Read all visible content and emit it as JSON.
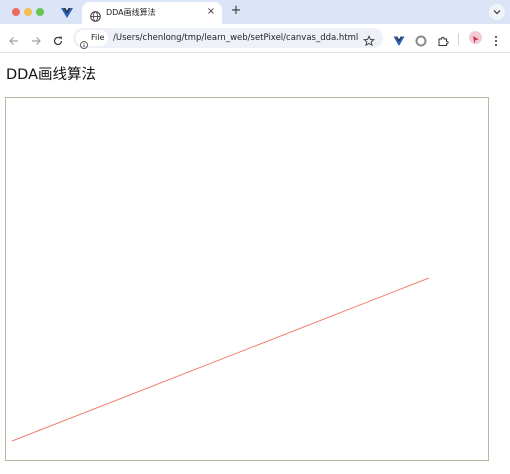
{
  "browser": {
    "tab": {
      "title": "DDA画线算法",
      "close_glyph": "×"
    },
    "new_tab_glyph": "+",
    "address_bar": {
      "scheme_label": "File",
      "url": "/Users/chenlong/tmp/learn_web/setPixel/canvas_dda.html"
    },
    "icons": {
      "pinned_tab": "vue-icon",
      "tab_favicon": "globe-icon",
      "back": "arrow-left-icon",
      "forward": "arrow-right-icon",
      "reload": "reload-icon",
      "site_info": "info-icon",
      "bookmark": "star-icon",
      "extensions": [
        "vue-devtools-icon",
        "circle-extension-icon",
        "puzzle-icon"
      ],
      "menu": "kebab-menu-icon"
    }
  },
  "page": {
    "heading": "DDA画线算法",
    "line_color": "#f08070",
    "canvas_border_color": "#b7b7a4"
  }
}
